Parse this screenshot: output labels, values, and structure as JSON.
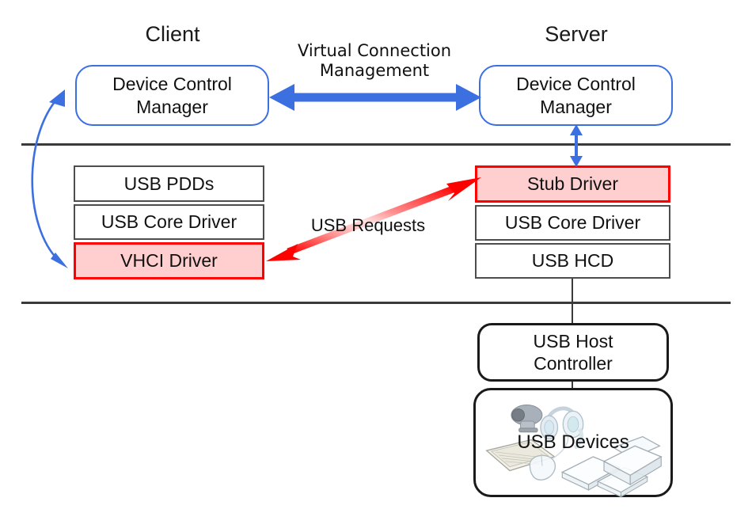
{
  "diagram": {
    "title_client": "Client",
    "title_server": "Server",
    "client": {
      "manager": "Device Control\nManager",
      "manager_line1": "Device Control",
      "manager_line2": "Manager",
      "stack": [
        {
          "label": "USB PDDs",
          "highlight": false
        },
        {
          "label": "USB Core Driver",
          "highlight": false
        },
        {
          "label": "VHCI Driver",
          "highlight": true
        }
      ]
    },
    "server": {
      "manager_line1": "Device Control",
      "manager_line2": "Manager",
      "stack": [
        {
          "label": "Stub Driver",
          "highlight": true
        },
        {
          "label": "USB Core Driver",
          "highlight": false
        },
        {
          "label": "USB HCD",
          "highlight": false
        }
      ],
      "host_controller_line1": "USB Host",
      "host_controller_line2": "Controller",
      "devices_label": "USB Devices"
    },
    "connections": {
      "virtual_connection_line1": "Virtual Connection",
      "virtual_connection_line2": "Management",
      "usb_requests": "USB Requests"
    },
    "colors": {
      "blue_arrow": "#3c6fe0",
      "red_arrow": "#ff0000",
      "highlight_fill": "#ffcfcf",
      "highlight_border": "#ff0000",
      "box_border": "#4d4d4d",
      "divider": "#3a3a3a",
      "text": "#111111"
    }
  }
}
